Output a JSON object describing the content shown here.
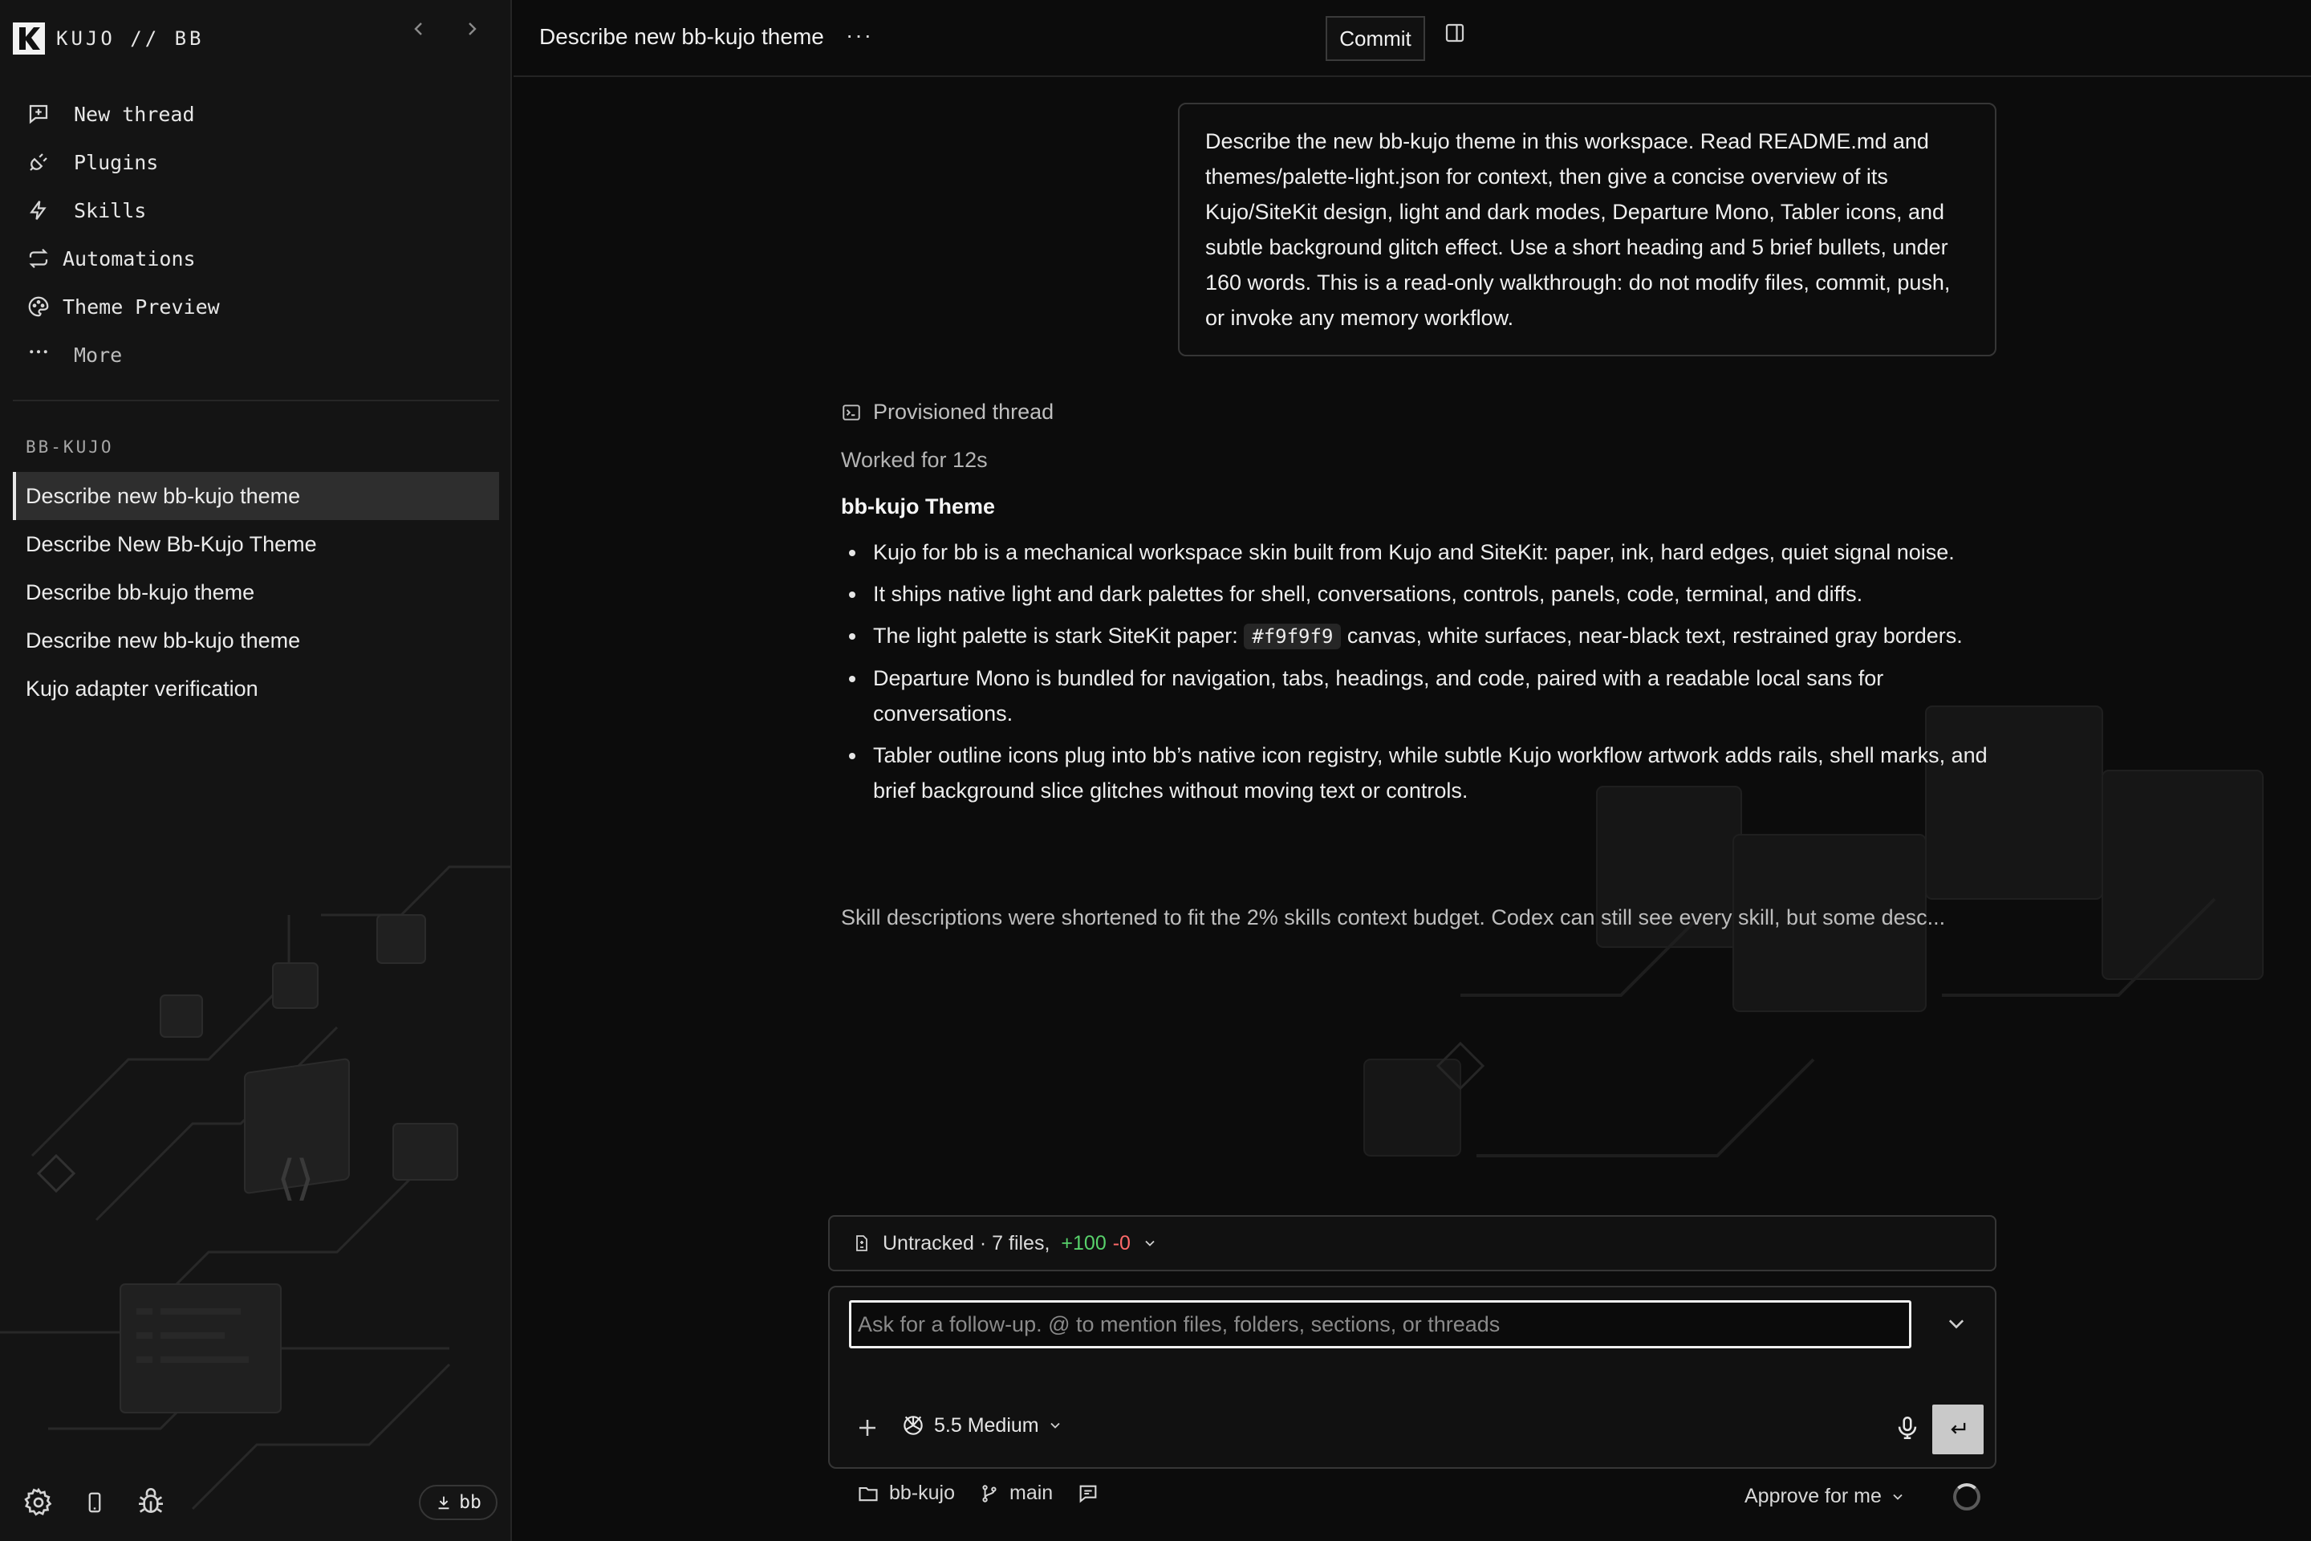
{
  "app": {
    "brand": "KUJO // BB"
  },
  "nav": {
    "new_thread": "New thread",
    "plugins": "Plugins",
    "skills": "Skills",
    "automations": "Automations",
    "theme_preview": "Theme Preview",
    "more": "More"
  },
  "sidebar": {
    "section_label": "BB-KUJO",
    "threads": [
      "Describe new bb-kujo theme",
      "Describe New Bb-Kujo Theme",
      "Describe bb-kujo theme",
      "Describe new bb-kujo theme",
      "Kujo adapter verification"
    ],
    "bb_button": "bb"
  },
  "topbar": {
    "title": "Describe new bb-kujo theme",
    "menu": "···",
    "commit": "Commit"
  },
  "conversation": {
    "user_message": "Describe the new bb-kujo theme in this workspace. Read README.md and themes/palette-light.json for context, then give a concise overview of its Kujo/SiteKit design, light and dark modes, Departure Mono, Tabler icons, and subtle background glitch effect. Use a short heading and 5 brief bullets, under 160 words. This is a read-only walkthrough: do not modify files, commit, push, or invoke any memory workflow.",
    "provisioned": "Provisioned thread",
    "worked": "Worked for 12s",
    "answer_title": "bb-kujo Theme",
    "bullets": {
      "b1": "Kujo for bb is a mechanical workspace skin built from Kujo and SiteKit: paper, ink, hard edges, quiet signal noise.",
      "b2": "It ships native light and dark palettes for shell, conversations, controls, panels, code, terminal, and diffs.",
      "b3_pre": "The light palette is stark SiteKit paper:",
      "b3_code": "#f9f9f9",
      "b3_post": "canvas, white surfaces, near-black text, restrained gray borders.",
      "b4": "Departure Mono is bundled for navigation, tabs, headings, and code, paired with a readable local sans for conversations.",
      "b5": "Tabler outline icons plug into bb’s native icon registry, while subtle Kujo workflow artwork adds rails, shell marks, and brief background slice glitches without moving text or controls."
    },
    "skill_note": "Skill descriptions were shortened to fit the 2% skills context budget. Codex can still see every skill, but some desc..."
  },
  "untracked": {
    "label": "Untracked · 7 files,",
    "added": "+100",
    "removed": "-0"
  },
  "composer": {
    "placeholder": "Ask for a follow-up. @ to mention files, folders, sections, or threads",
    "value": "",
    "model": "5.5 Medium"
  },
  "bottom": {
    "folder": "bb-kujo",
    "branch": "main",
    "approve": "Approve for me"
  },
  "colors": {
    "background": "#0c0c0c",
    "sidebar": "#141414",
    "added": "#58d26b",
    "removed": "#ff6a6a"
  }
}
